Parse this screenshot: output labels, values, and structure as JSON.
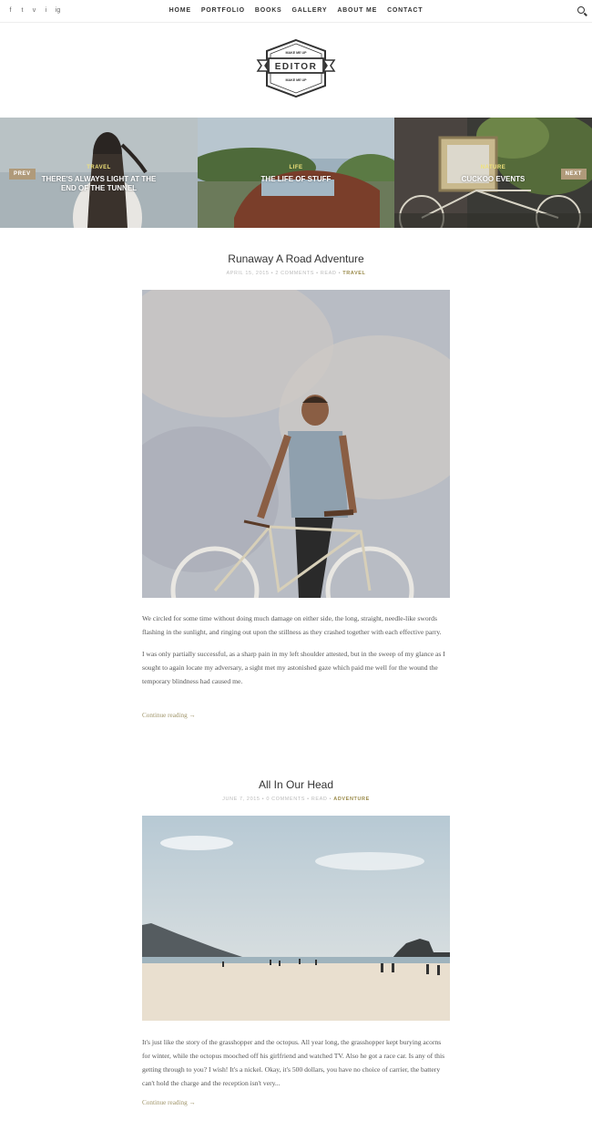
{
  "nav": {
    "social": [
      "f",
      "t",
      "v",
      "i",
      "ig"
    ],
    "items": [
      "HOME",
      "PORTFOLIO",
      "BOOKS",
      "GALLERY",
      "ABOUT ME",
      "CONTACT"
    ]
  },
  "logo": {
    "top": "MAKE ME UP",
    "main": "EDITOR",
    "bottom": "MAKE ME UP"
  },
  "slider": {
    "prev": "PREV",
    "next": "NEXT",
    "slides": [
      {
        "category": "TRAVEL",
        "title_line1": "THERE'S ALWAYS LIGHT AT THE",
        "title_line2": "END OF THE TUNNEL"
      },
      {
        "category": "LIFE",
        "title_line1": "THE LIFE OF STUFF",
        "title_line2": ""
      },
      {
        "category": "NATURE",
        "title_line1": "CUCKOO EVENTS",
        "title_line2": ""
      }
    ]
  },
  "posts": [
    {
      "title": "Runaway A Road Adventure",
      "meta_prefix": "APRIL 15, 2015  •  2 COMMENTS  •  READ  •",
      "category": "TRAVEL",
      "paragraphs": [
        "We circled for some time without doing much damage on either side, the long, straight, needle-like swords flashing in the sunlight, and ringing out upon the stillness as they crashed together with each effective parry.",
        "I was only partially successful, as a sharp pain in my left shoulder attested, but in the sweep of my glance as I sought to again locate my adversary, a sight met my astonished gaze which paid me well for the wound the temporary blindness had caused me."
      ],
      "more": "Continue reading →"
    },
    {
      "title": "All In Our Head",
      "meta_prefix": "JUNE 7, 2015  •  0 COMMENTS  •  READ  •",
      "category": "ADVENTURE",
      "paragraphs": [
        "It's just like the story of the grasshopper and the octopus. All year long, the grasshopper kept burying acorns for winter, while the octopus mooched off his girlfriend and watched TV. Also he got a race car. Is any of this getting through to you? I wish! It's a nickel. Okay, it's 500 dollars, you have no choice of carrier, the battery can't hold the charge and the reception isn't very..."
      ],
      "more": "Continue reading →"
    }
  ],
  "colors": {
    "accent": "#b09a7a",
    "category": "#9a8a4a",
    "slide_category": "#f0e27a"
  }
}
